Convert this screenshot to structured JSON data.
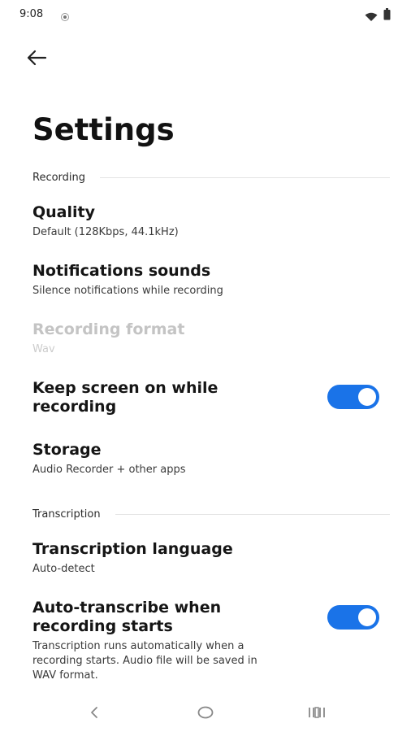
{
  "status_bar": {
    "time": "9:08",
    "icons": [
      "notification-dot-icon",
      "wifi-icon",
      "battery-icon"
    ]
  },
  "header": {
    "back_icon": "arrow-back-icon",
    "title": "Settings"
  },
  "sections": {
    "recording": {
      "label": "Recording",
      "items": [
        {
          "title": "Quality",
          "subtitle": "Default (128Kbps, 44.1kHz)"
        },
        {
          "title": "Notifications sounds",
          "subtitle": "Silence notifications while recording"
        },
        {
          "title": "Recording format",
          "subtitle": "Wav",
          "disabled": true
        },
        {
          "title": "Keep screen on while recording",
          "toggle": true
        },
        {
          "title": "Storage",
          "subtitle": "Audio Recorder + other apps"
        }
      ]
    },
    "transcription": {
      "label": "Transcription",
      "items": [
        {
          "title": "Transcription language",
          "subtitle": "Auto-detect"
        },
        {
          "title": "Auto-transcribe when recording starts",
          "subtitle": "Transcription runs automatically when a recording starts. Audio file will be saved in WAV format.",
          "toggle": true
        }
      ]
    }
  },
  "colors": {
    "accent": "#1a73e8",
    "background": "#ffffff",
    "disabled_text": "#c4c4c4"
  },
  "nav_bar": {
    "icons": [
      "nav-back-icon",
      "nav-home-icon",
      "nav-recents-icon"
    ]
  }
}
